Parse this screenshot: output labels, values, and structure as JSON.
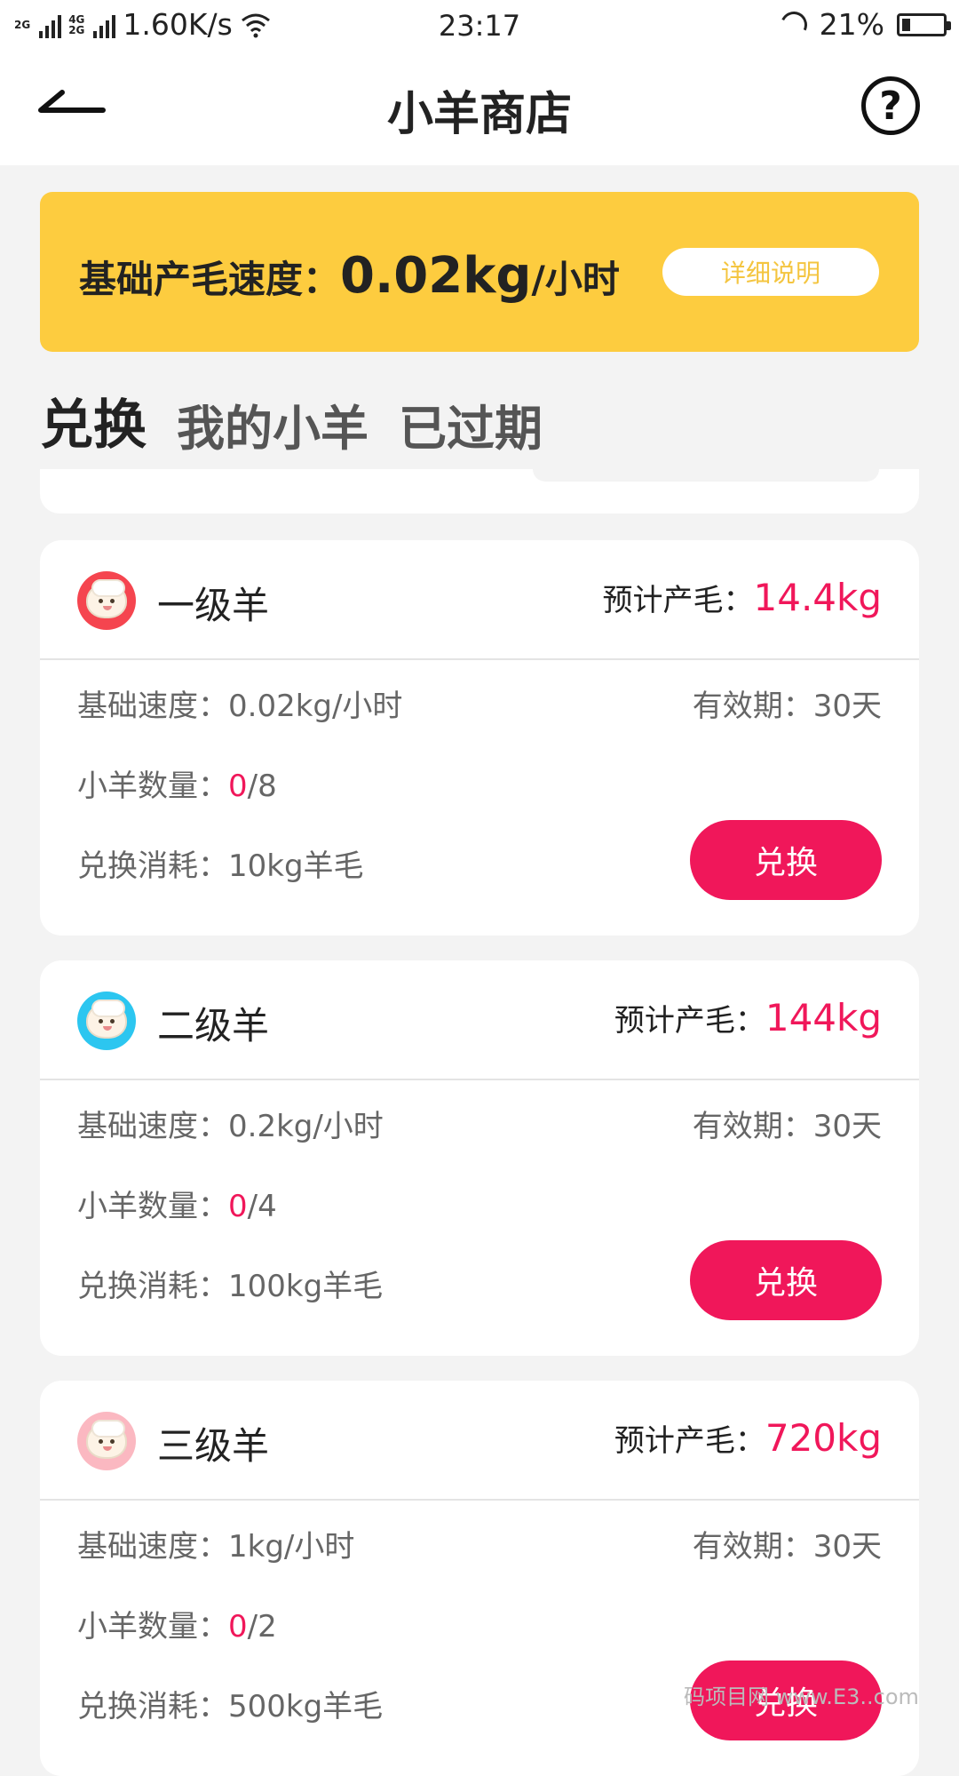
{
  "status_bar": {
    "net_1": "2G",
    "net_2a": "4G",
    "net_2b": "2G",
    "speed": "1.60K/s",
    "time": "23:17",
    "battery": "21%",
    "battery_level": 0.21
  },
  "nav": {
    "title": "小羊商店",
    "help": "?"
  },
  "banner": {
    "label": "基础产毛速度：",
    "value": "0.02kg",
    "unit": "/小时",
    "detail_btn": "详细说明"
  },
  "tabs": [
    "兑换",
    "我的小羊",
    "已过期"
  ],
  "cards": [
    {
      "avatar_color": "#f5454f",
      "name": "一级羊",
      "est_label": "预计产毛：",
      "est_value": "14.4kg",
      "speed": "基础速度：0.02kg/小时",
      "validity": "有效期：30天",
      "count_label": "小羊数量：",
      "count_owned": "0",
      "count_total": "/8",
      "cost": "兑换消耗：10kg羊毛",
      "btn": "兑换"
    },
    {
      "avatar_color": "#2cc6f0",
      "name": "二级羊",
      "est_label": "预计产毛：",
      "est_value": "144kg",
      "speed": "基础速度：0.2kg/小时",
      "validity": "有效期：30天",
      "count_label": "小羊数量：",
      "count_owned": "0",
      "count_total": "/4",
      "cost": "兑换消耗：100kg羊毛",
      "btn": "兑换"
    },
    {
      "avatar_color": "#fbb8c1",
      "name": "三级羊",
      "est_label": "预计产毛：",
      "est_value": "720kg",
      "speed": "基础速度：1kg/小时",
      "validity": "有效期：30天",
      "count_label": "小羊数量：",
      "count_owned": "0",
      "count_total": "/2",
      "cost": "兑换消耗：500kg羊毛",
      "btn": "兑换"
    }
  ],
  "watermark": "码项目网 www.E3..com"
}
